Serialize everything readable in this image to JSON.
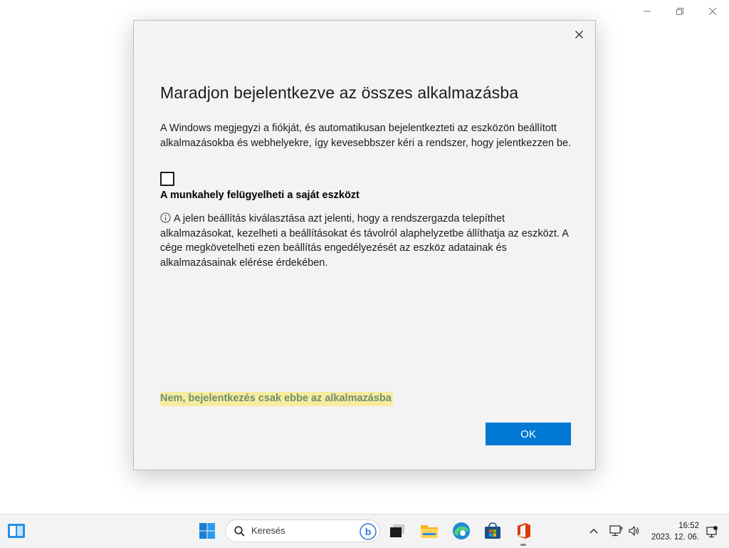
{
  "dialog": {
    "title": "Maradjon bejelentkezve az összes alkalmazásba",
    "description": "A Windows megjegyzi a fiókját, és automatikusan bejelentkezteti az eszközön beállított alkalmazásokba és webhelyekre, így kevesebbszer kéri a rendszer, hogy jelentkezzen be.",
    "checkbox_label": "A munkahely felügyelheti a saját eszközt",
    "checkbox_checked": false,
    "info_text": "A jelen beállítás kiválasztása azt jelenti, hogy a rendszergazda telepíthet alkalmazásokat, kezelheti a beállításokat és távolról alaphelyzetbe állíthatja az eszközt. A cége megkövetelheti ezen beállítás engedélyezését az eszköz adatainak és alkalmazásainak elérése érdekében.",
    "no_link_label": "Nem, bejelentkezés csak ebbe az alkalmazásba",
    "ok_label": "OK"
  },
  "taskbar": {
    "search_placeholder": "Keresés",
    "time": "16:52",
    "date": "2023. 12. 06."
  },
  "colors": {
    "accent": "#0078d4",
    "highlight": "#f6ec9c",
    "link_text": "#6f8e72"
  },
  "icons": {
    "taskbar_left": "widgets-icon",
    "start": "windows-start-icon",
    "search": "search-icon",
    "bing": "bing-icon",
    "task_view": "task-view-icon",
    "explorer": "file-explorer-icon",
    "edge": "edge-icon",
    "store": "microsoft-store-icon",
    "office": "office-icon",
    "tray": [
      "chevron-up-icon",
      "network-icon",
      "volume-icon",
      "notification-icon"
    ]
  }
}
